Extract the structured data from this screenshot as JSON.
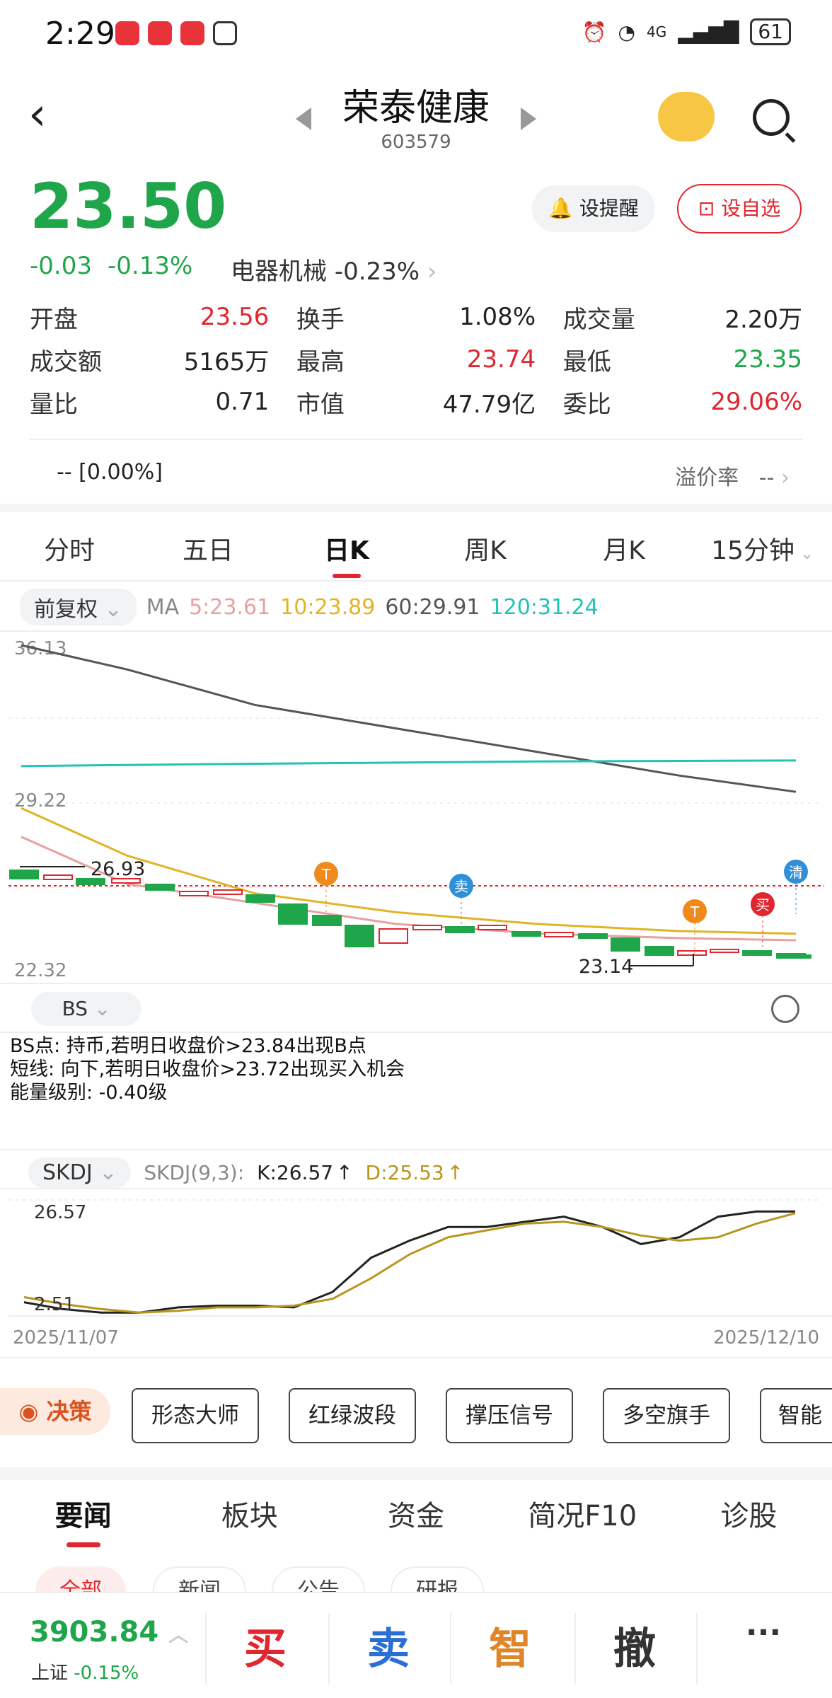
{
  "status": {
    "time": "2:29",
    "net": "4G",
    "battery": "61"
  },
  "header": {
    "title": "荣泰健康",
    "code": "603579",
    "remind": "设提醒",
    "fav": "设自选"
  },
  "quote": {
    "price": "23.50",
    "chg": "-0.03",
    "pct": "-0.13%",
    "sector": "电器机械",
    "sector_pct": "-0.23%"
  },
  "stats": [
    [
      {
        "l": "开盘",
        "v": "23.56",
        "c": "r"
      },
      {
        "l": "换手",
        "v": "1.08%",
        "c": ""
      },
      {
        "l": "成交量",
        "v": "2.20万",
        "c": ""
      }
    ],
    [
      {
        "l": "成交额",
        "v": "5165万",
        "c": ""
      },
      {
        "l": "最高",
        "v": "23.74",
        "c": "r"
      },
      {
        "l": "最低",
        "v": "23.35",
        "c": "g"
      }
    ],
    [
      {
        "l": "量比",
        "v": "0.71",
        "c": ""
      },
      {
        "l": "市值",
        "v": "47.79亿",
        "c": ""
      },
      {
        "l": "委比",
        "v": "29.06%",
        "c": "r"
      }
    ]
  ],
  "premium": {
    "left": "--  [0.00%]",
    "label": "溢价率",
    "value": "--"
  },
  "tabs": [
    "分时",
    "五日",
    "日K",
    "周K",
    "月K",
    "15分钟"
  ],
  "kline": {
    "adj": "前复权",
    "ma_label": "MA",
    "ma5": "5:23.61",
    "ma10": "10:23.89",
    "ma60": "60:29.91",
    "ma120": "120:31.24",
    "y_top": "36.13",
    "y_mid": "29.22",
    "y_bot": "22.32",
    "hi_label": "26.93",
    "lo_label": "23.14",
    "markers": [
      "T",
      "卖",
      "T",
      "买",
      "清"
    ]
  },
  "bs": {
    "pill": "BS",
    "lines": [
      "BS点: 持币,若明日收盘价>23.84出现B点",
      "短线: 向下,若明日收盘价>23.72出现买入机会",
      "能量级别: -0.40级"
    ]
  },
  "skdj": {
    "pill": "SKDJ",
    "params": "SKDJ(9,3):",
    "k": "K:26.57",
    "d": "D:25.53",
    "y_top": "26.57",
    "y_bot": "2.51"
  },
  "dates": {
    "start": "2025/11/07",
    "end": "2025/12/10"
  },
  "tools": {
    "jc": "决策",
    "items": [
      "形态大师",
      "红绿波段",
      "撑压信号",
      "多空旗手",
      "智能"
    ]
  },
  "news": {
    "tabs": [
      "要闻",
      "板块",
      "资金",
      "简况F10",
      "诊股"
    ],
    "sub": [
      "全部",
      "新闻",
      "公告",
      "研报"
    ]
  },
  "bottom": {
    "index": "3903.84",
    "index_name": "上证",
    "index_pct": "-0.15%",
    "buy": "买",
    "sell": "卖",
    "smart": "智",
    "cancel": "撤",
    "more": "···"
  },
  "colors": {
    "red": "#e0262f",
    "green": "#1fa64b",
    "ma5": "#e8a0a0",
    "ma10": "#e2b325",
    "ma60": "#555555",
    "ma120": "#22c3b4"
  },
  "chart_data": [
    {
      "type": "line",
      "title": "",
      "series": [
        {
          "name": "MA60",
          "values": [
            36.13,
            35.1,
            33.6,
            32.6,
            31.6,
            30.6,
            29.91
          ]
        },
        {
          "name": "MA120",
          "values": [
            31.0,
            31.05,
            31.1,
            31.15,
            31.2,
            31.22,
            31.24
          ]
        },
        {
          "name": "MA10",
          "values": [
            29.22,
            27.2,
            25.6,
            24.8,
            24.3,
            24.0,
            23.89
          ]
        },
        {
          "name": "MA5",
          "values": [
            28.0,
            26.0,
            25.2,
            24.3,
            23.9,
            23.7,
            23.61
          ]
        }
      ],
      "ylim": [
        22.32,
        36.13
      ]
    },
    {
      "type": "line",
      "title": "",
      "series": [
        {
          "name": "K",
          "values": [
            8,
            4,
            2,
            2,
            5,
            6,
            6,
            5,
            14,
            34,
            44,
            52,
            52,
            55,
            58,
            52,
            42,
            46,
            58,
            61,
            61
          ]
        },
        {
          "name": "D",
          "values": [
            11,
            7,
            4,
            2,
            3,
            5,
            5,
            6,
            10,
            22,
            36,
            46,
            50,
            54,
            55,
            52,
            47,
            44,
            46,
            54,
            60
          ]
        }
      ],
      "ylim": [
        2.51,
        26.57
      ]
    }
  ]
}
